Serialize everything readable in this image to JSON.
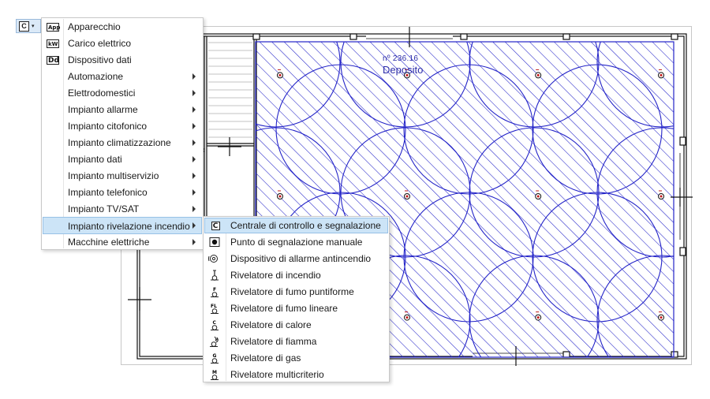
{
  "toolbar": {
    "button_glyph": "C",
    "caret": "▾"
  },
  "drawing": {
    "room_number": "nº 236.16",
    "room_name": "Deposito",
    "coverage_color": "#2323c8",
    "detectors": [
      [
        0.05,
        0.1
      ],
      [
        0.36,
        0.1
      ],
      [
        0.68,
        0.1
      ],
      [
        0.98,
        0.1
      ],
      [
        0.05,
        0.5
      ],
      [
        0.36,
        0.5
      ],
      [
        0.68,
        0.5
      ],
      [
        0.98,
        0.5
      ],
      [
        0.05,
        0.9
      ],
      [
        0.36,
        0.9
      ],
      [
        0.68,
        0.9
      ],
      [
        0.98,
        0.9
      ]
    ]
  },
  "menu": {
    "items": [
      {
        "icon": "App",
        "label": "Apparecchio",
        "submenu": false
      },
      {
        "icon": "kW",
        "label": "Carico elettrico",
        "submenu": false
      },
      {
        "icon": "Dd",
        "label": "Dispositivo dati",
        "submenu": false
      },
      {
        "icon": "",
        "label": "Automazione",
        "submenu": true
      },
      {
        "icon": "",
        "label": "Elettrodomestici",
        "submenu": true
      },
      {
        "icon": "",
        "label": "Impianto allarme",
        "submenu": true
      },
      {
        "icon": "",
        "label": "Impianto citofonico",
        "submenu": true
      },
      {
        "icon": "",
        "label": "Impianto climatizzazione",
        "submenu": true
      },
      {
        "icon": "",
        "label": "Impianto dati",
        "submenu": true
      },
      {
        "icon": "",
        "label": "Impianto multiservizio",
        "submenu": true
      },
      {
        "icon": "",
        "label": "Impianto telefonico",
        "submenu": true
      },
      {
        "icon": "",
        "label": "Impianto TV/SAT",
        "submenu": true
      },
      {
        "icon": "",
        "label": "Impianto rivelazione incendio",
        "submenu": true
      },
      {
        "icon": "",
        "label": "Macchine elettriche",
        "submenu": true
      }
    ]
  },
  "submenu": {
    "items": [
      {
        "icon": "C",
        "label": "Centrale di controllo e segnalazione"
      },
      {
        "icon": "",
        "label": "Punto di segnalazione manuale"
      },
      {
        "icon": "",
        "label": "Dispositivo di allarme antincendio"
      },
      {
        "icon": "",
        "label": "Rivelatore di incendio"
      },
      {
        "icon": "F",
        "label": "Rivelatore di fumo puntiforme"
      },
      {
        "icon": "FL",
        "label": "Rivelatore di fumo lineare"
      },
      {
        "icon": "C",
        "label": "Rivelatore di calore"
      },
      {
        "icon": "",
        "label": "Rivelatore di fiamma"
      },
      {
        "icon": "G",
        "label": "Rivelatore di gas"
      },
      {
        "icon": "M",
        "label": "Rivelatore multicriterio"
      }
    ]
  }
}
